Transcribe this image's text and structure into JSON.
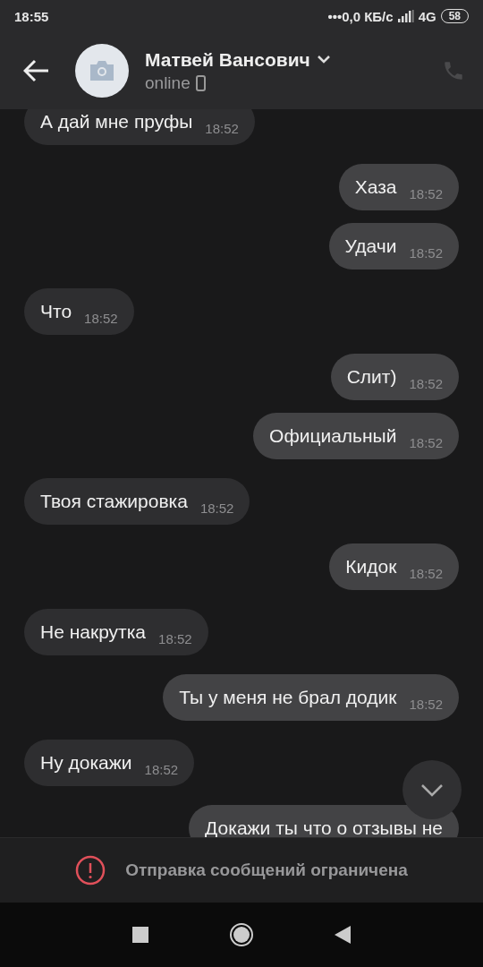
{
  "status_bar": {
    "time": "18:55",
    "network_speed": "•••0,0 КБ/с",
    "network_type": "4G",
    "battery": "58"
  },
  "header": {
    "name": "Матвей Вансович",
    "status": "online"
  },
  "messages": [
    {
      "kind": "incoming",
      "text": "А дай мне пруфы",
      "time": "18:52"
    },
    {
      "kind": "outgoing",
      "text": "Хаза",
      "time": "18:52"
    },
    {
      "kind": "outgoing",
      "text": "Удачи",
      "time": "18:52"
    },
    {
      "kind": "incoming",
      "text": "Что",
      "time": "18:52"
    },
    {
      "kind": "outgoing",
      "text": "Слит)",
      "time": "18:52"
    },
    {
      "kind": "outgoing",
      "text": "Официальный",
      "time": "18:52"
    },
    {
      "kind": "incoming",
      "text": "Твоя стажировка",
      "time": "18:52"
    },
    {
      "kind": "outgoing",
      "text": "Кидок",
      "time": "18:52"
    },
    {
      "kind": "incoming",
      "text": "Не накрутка",
      "time": "18:52"
    },
    {
      "kind": "outgoing",
      "text": "Ты у меня не брал додик",
      "time": "18:52"
    },
    {
      "kind": "incoming",
      "text": "Ну докажи",
      "time": "18:52"
    },
    {
      "kind": "outgoing",
      "text": "Докажи ты что о отзывы не"
    }
  ],
  "notice": "Отправка сообщений ограничена"
}
